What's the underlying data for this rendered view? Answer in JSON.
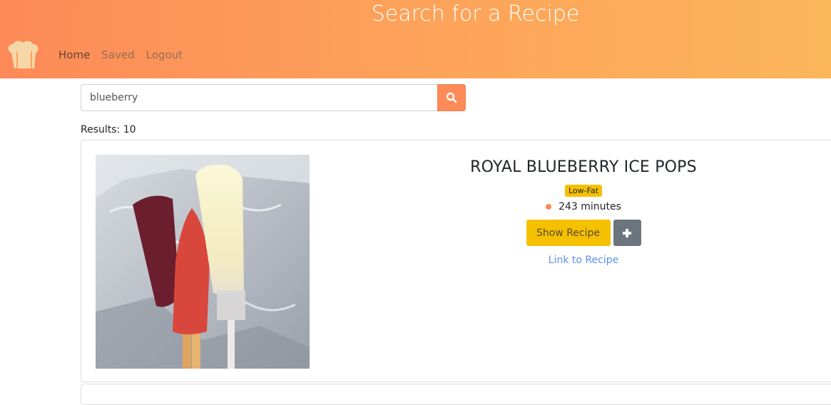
{
  "header": {
    "title": "Search for a Recipe",
    "nav": [
      "Home",
      "Saved",
      "Logout"
    ]
  },
  "search": {
    "value": "blueberry",
    "placeholder": ""
  },
  "results": {
    "label": "Results: 10"
  },
  "recipe": {
    "title": "ROYAL BLUEBERRY ICE POPS",
    "badge": "Low-Fat",
    "time": "243 minutes",
    "show_button": "Show Recipe",
    "add_button": "+",
    "link": "Link to Recipe"
  },
  "colors": {
    "accent": "#fd8a58",
    "badge": "#f5c000",
    "link": "#5b8ff0"
  },
  "icons": {
    "logo": "chef-hat-icon",
    "search": "search-icon",
    "add": "plus-icon"
  }
}
